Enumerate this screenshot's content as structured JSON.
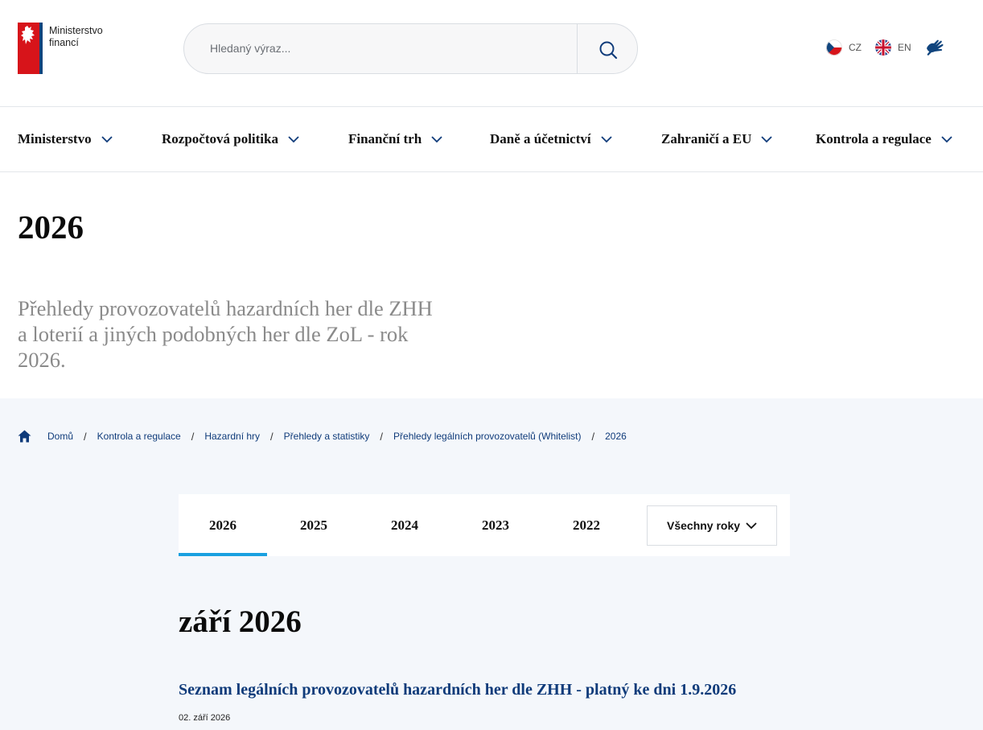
{
  "header": {
    "logo_line1": "Ministerstvo",
    "logo_line2": "financí",
    "search_placeholder": "Hledaný výraz...",
    "languages": [
      {
        "code": "CZ"
      },
      {
        "code": "EN"
      }
    ]
  },
  "nav": {
    "items": [
      {
        "label": "Ministerstvo"
      },
      {
        "label": "Rozpočtová politika"
      },
      {
        "label": "Finanční trh"
      },
      {
        "label": "Daně a účetnictví"
      },
      {
        "label": "Zahraničí a EU"
      },
      {
        "label": "Kontrola a regulace"
      }
    ]
  },
  "hero": {
    "title": "2026",
    "subtitle": "Přehledy provozovatelů hazardních her dle ZHH a loterií a jiných podobných her dle ZoL - rok 2026."
  },
  "breadcrumb": [
    "Domů",
    "Kontrola a regulace",
    "Hazardní hry",
    "Přehledy a statistiky",
    "Přehledy legálních provozovatelů (Whitelist)",
    "2026"
  ],
  "tabs": {
    "items": [
      "2026",
      "2025",
      "2024",
      "2023",
      "2022"
    ],
    "active": "2026",
    "all_years_label": "Všechny roky"
  },
  "content": {
    "month_heading": "září 2026",
    "item_title": "Seznam legálních provozovatelů hazardních her dle ZHH - platný ke dni 1.9.2026",
    "item_date": "02. září 2026"
  },
  "colors": {
    "brand_blue": "#0f3b7a",
    "accent": "#1aa0e0",
    "red": "#d7141a"
  }
}
